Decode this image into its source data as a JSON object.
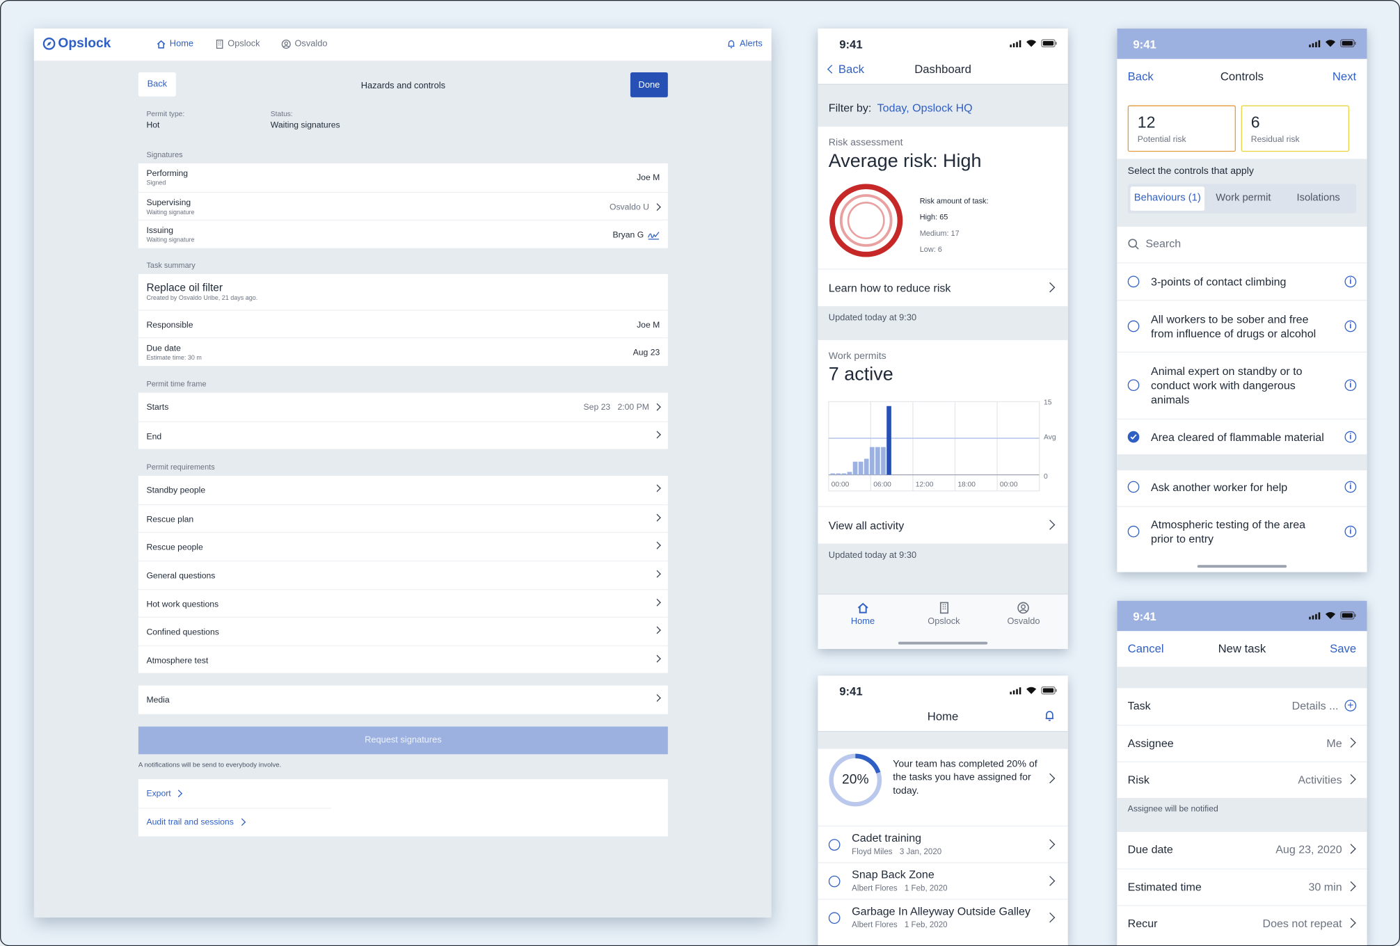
{
  "desktop": {
    "brand": "Opslock",
    "nav": [
      {
        "label": "Home",
        "icon": "home-icon"
      },
      {
        "label": "Opslock",
        "icon": "building-icon"
      },
      {
        "label": "Osvaldo",
        "icon": "user-icon"
      }
    ],
    "alerts": "Alerts",
    "back": "Back",
    "title": "Hazards and controls",
    "done": "Done",
    "permit_type_label": "Permit type:",
    "permit_type": "Hot",
    "status_label": "Status:",
    "status": "Waiting signatures",
    "signatures_title": "Signatures",
    "signatures": [
      {
        "role": "Performing",
        "sub": "Signed",
        "value": "Joe M"
      },
      {
        "role": "Supervising",
        "sub": "Waiting signature",
        "value": "Osvaldo U"
      },
      {
        "role": "Issuing",
        "sub": "Waiting signature",
        "value": "Bryan G"
      }
    ],
    "task_summary_title": "Task summary",
    "task_name": "Replace oil filter",
    "task_created": "Created by Osvaldo Uribe, 21 days ago.",
    "responsible_label": "Responsible",
    "responsible": "Joe M",
    "due_label": "Due date",
    "due_sub": "Estimate time: 30 m",
    "due": "Aug 23",
    "timeframe_title": "Permit time frame",
    "starts_label": "Starts",
    "starts_date": "Sep 23",
    "starts_time": "2:00 PM",
    "end_label": "End",
    "requirements_title": "Permit requirements",
    "requirements": [
      "Standby people",
      "Rescue plan",
      "Rescue people",
      "General questions",
      "Hot work questions",
      "Confined questions",
      "Atmosphere test"
    ],
    "media": "Media",
    "request": "Request signatures",
    "notify": "A notifications will be send to everybody involve.",
    "export": "Export",
    "audit": "Audit trail and sessions"
  },
  "dashboard": {
    "time": "9:41",
    "back": "Back",
    "title": "Dashboard",
    "filter_label": "Filter by:",
    "filter_value": "Today, Opslock HQ",
    "risk_label": "Risk assessment",
    "risk_title": "Average risk: High",
    "risk_amount": "Risk amount of task:",
    "risk_high": "High: 65",
    "risk_medium": "Medium: 17",
    "risk_low": "Low: 6",
    "learn": "Learn how to reduce risk",
    "updated1": "Updated today at 9:30",
    "permits_label": "Work permits",
    "permits_title": "7 active",
    "chart_y_top": "15",
    "chart_y_avg": "Avg",
    "chart_y_bottom": "0",
    "chart_x": [
      "00:00",
      "06:00",
      "12:00",
      "18:00",
      "00:00"
    ],
    "view_all": "View all activity",
    "updated2": "Updated today at 9:30",
    "tabs": [
      "Home",
      "Opslock",
      "Osvaldo"
    ]
  },
  "chart_data": {
    "type": "bar",
    "ylim": [
      0,
      15
    ],
    "x": [
      "00:00",
      "01:00",
      "02:00",
      "03:00",
      "04:00",
      "05:00",
      "06:00",
      "07:00",
      "08:00",
      "09:00",
      "10:00",
      "11:00"
    ],
    "values": [
      0.3,
      0.3,
      0.3,
      0.6,
      2.7,
      2.7,
      3.3,
      5.7,
      5.7,
      5.7,
      14.1,
      0
    ],
    "avg": 7.5,
    "xticks": [
      "00:00",
      "06:00",
      "12:00",
      "18:00",
      "00:00"
    ],
    "yticks": [
      "15",
      "Avg",
      "0"
    ]
  },
  "controls": {
    "time": "9:41",
    "back": "Back",
    "title": "Controls",
    "next": "Next",
    "potential_value": "12",
    "potential_label": "Potential risk",
    "residual_value": "6",
    "residual_label": "Residual risk",
    "select_label": "Select the controls that apply",
    "tabs": [
      "Behaviours (1)",
      "Work permit",
      "Isolations"
    ],
    "search_placeholder": "Search",
    "items": [
      "3-points of contact climbing",
      "All workers to be sober and free from influence of drugs or alcohol",
      "Animal expert on standby or to conduct work with dangerous animals",
      "Area cleared of flammable material",
      "Ask another worker for help",
      "Atmospheric testing of the area prior to entry"
    ]
  },
  "home": {
    "time": "9:41",
    "title": "Home",
    "progress": "20%",
    "progress_value": 0.2,
    "progress_text": "Your team has completed 20% of the tasks you have assigned for today.",
    "tasks": [
      {
        "name": "Cadet training",
        "person": "Floyd Miles",
        "date": "3 Jan, 2020"
      },
      {
        "name": "Snap Back Zone",
        "person": "Albert Flores",
        "date": "1 Feb, 2020"
      },
      {
        "name": "Garbage In Alleyway Outside Galley",
        "person": "Albert Flores",
        "date": "1 Feb, 2020"
      }
    ]
  },
  "newtask": {
    "time": "9:41",
    "cancel": "Cancel",
    "title": "New task",
    "save": "Save",
    "task_label": "Task",
    "task_value": "Details ...",
    "assignee_label": "Assignee",
    "assignee_value": "Me",
    "risk_label": "Risk",
    "risk_value": "Activities",
    "notified": "Assignee will be notified",
    "due_label": "Due date",
    "due_value": "Aug 23, 2020",
    "est_label": "Estimated time",
    "est_value": "30 min",
    "recur_label": "Recur",
    "recur_value": "Does not repeat"
  }
}
